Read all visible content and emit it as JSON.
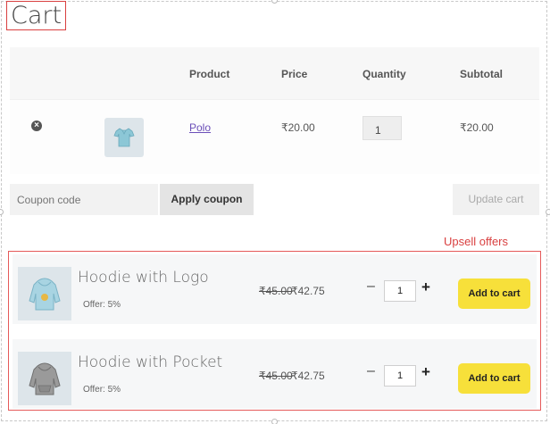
{
  "page_title": "Cart",
  "table": {
    "headers": {
      "product": "Product",
      "price": "Price",
      "quantity": "Quantity",
      "subtotal": "Subtotal"
    },
    "rows": [
      {
        "remove_icon": "remove-circle-icon",
        "thumb_icon": "polo-shirt-icon",
        "product": "Polo",
        "price": "₹20.00",
        "quantity": "1",
        "subtotal": "₹20.00"
      }
    ]
  },
  "actions": {
    "coupon_placeholder": "Coupon code",
    "apply_coupon": "Apply coupon",
    "update_cart": "Update cart"
  },
  "upsell": {
    "label": "Upsell offers",
    "items": [
      {
        "name": "Hoodie with Logo",
        "offer": "Offer: 5%",
        "old_price": "₹45.00",
        "new_price": "₹42.75",
        "quantity": "1",
        "minus": "–",
        "plus": "+",
        "add_label": "Add to cart",
        "thumb_icon": "hoodie-logo-icon"
      },
      {
        "name": "Hoodie with Pocket",
        "offer": "Offer: 5%",
        "old_price": "₹45.00",
        "new_price": "₹42.75",
        "quantity": "1",
        "minus": "–",
        "plus": "+",
        "add_label": "Add to cart",
        "thumb_icon": "hoodie-pocket-icon"
      }
    ]
  },
  "colors": {
    "accent_red": "#d94040",
    "add_button": "#f7e03a",
    "link_purple": "#6b4fb8"
  }
}
